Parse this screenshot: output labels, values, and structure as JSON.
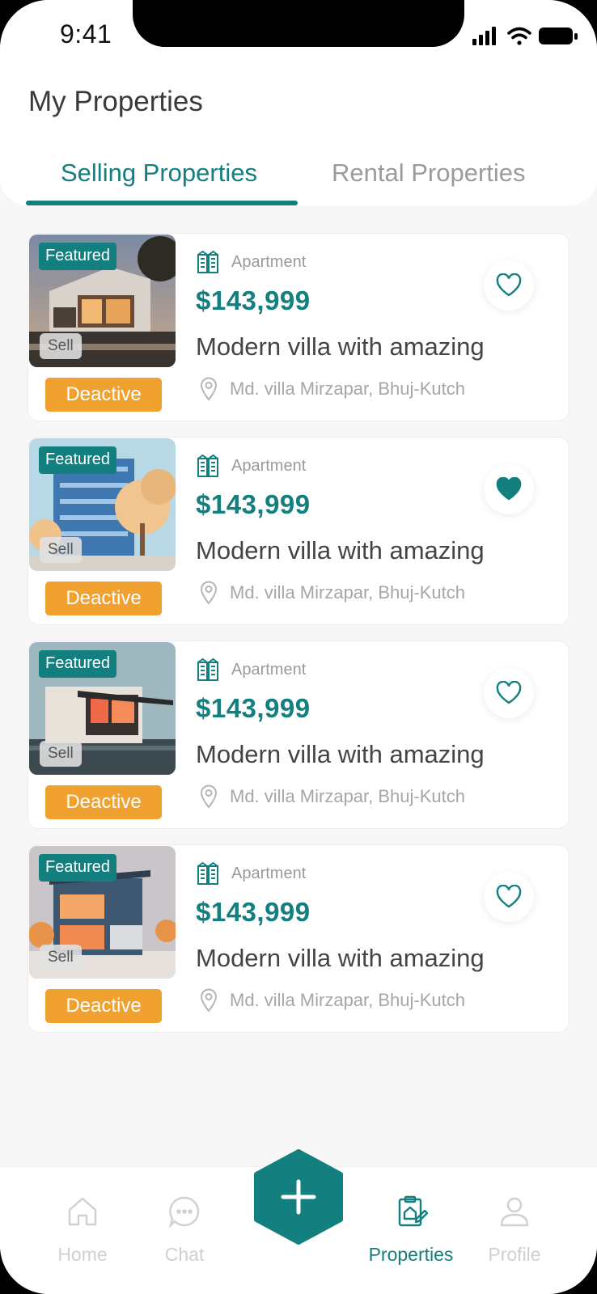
{
  "status_bar": {
    "time": "9:41"
  },
  "header": {
    "title": "My Properties"
  },
  "tabs": [
    {
      "label": "Selling Properties",
      "active": true
    },
    {
      "label": "Rental Properties",
      "active": false
    }
  ],
  "properties": [
    {
      "featured": "Featured",
      "sell": "Sell",
      "action": "Deactive",
      "type": "Apartment",
      "price": "$143,999",
      "title": "Modern villa with amazing",
      "location": "Md. villa Mirzapar, Bhuj-Kutch",
      "favorite": false
    },
    {
      "featured": "Featured",
      "sell": "Sell",
      "action": "Deactive",
      "type": "Apartment",
      "price": "$143,999",
      "title": "Modern villa with amazing",
      "location": "Md. villa Mirzapar, Bhuj-Kutch",
      "favorite": true
    },
    {
      "featured": "Featured",
      "sell": "Sell",
      "action": "Deactive",
      "type": "Apartment",
      "price": "$143,999",
      "title": "Modern villa with amazing",
      "location": "Md. villa Mirzapar, Bhuj-Kutch",
      "favorite": false
    },
    {
      "featured": "Featured",
      "sell": "Sell",
      "action": "Deactive",
      "type": "Apartment",
      "price": "$143,999",
      "title": "Modern villa with amazing",
      "location": "Md. villa Mirzapar, Bhuj-Kutch",
      "favorite": false
    }
  ],
  "bottom_nav": {
    "items": [
      {
        "label": "Home",
        "icon": "home-icon",
        "active": false
      },
      {
        "label": "Chat",
        "icon": "chat-icon",
        "active": false
      },
      {
        "label": "Properties",
        "icon": "properties-icon",
        "active": true
      },
      {
        "label": "Profile",
        "icon": "profile-icon",
        "active": false
      }
    ],
    "fab_icon": "plus-icon"
  },
  "colors": {
    "accent": "#137f7f",
    "warning": "#f0a12f",
    "inactive": "#d0d0d0"
  }
}
